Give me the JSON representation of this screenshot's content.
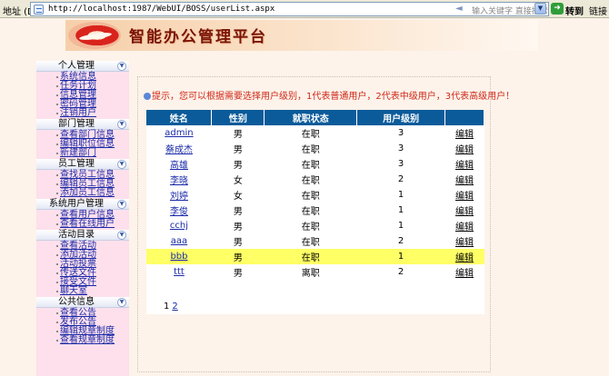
{
  "browser": {
    "address_label": "地址 (D)",
    "url": "http://localhost:1987/WebUI/BOSS/userList.aspx",
    "search_hint": "输入关键字 直接搜索",
    "go_label": "转到",
    "links_label": "链接"
  },
  "banner": {
    "title": "智能办公管理平台"
  },
  "sidebar": {
    "sections": [
      {
        "title": "个人管理",
        "items": [
          "系统信息",
          "任务计划",
          "信息管理",
          "密码管理",
          "注销用户"
        ]
      },
      {
        "title": "部门管理",
        "items": [
          "查看部门信息",
          "编辑职位信息",
          "新建部门"
        ]
      },
      {
        "title": "员工管理",
        "items": [
          "查找员工信息",
          "编辑员工信息",
          "添加员工信息"
        ]
      },
      {
        "title": "系统用户管理",
        "items": [
          "查看用户信息",
          "查看在线用户"
        ]
      },
      {
        "title": "活动目录",
        "items": [
          "查看活动",
          "添加活动",
          "活动投票",
          "传送文件",
          "接受文件",
          "聊天室"
        ]
      },
      {
        "title": "公共信息",
        "items": [
          "查看公告",
          "发布公告",
          "编辑规章制度",
          "查看规章制度"
        ]
      }
    ]
  },
  "hint": "提示，您可以根据需要选择用户级别，1代表普通用户，2代表中级用户，3代表高级用户！",
  "table": {
    "headers": [
      "姓名",
      "性别",
      "就职状态",
      "用户级别",
      ""
    ],
    "rows": [
      {
        "name": "admin",
        "gender": "男",
        "status": "在职",
        "level": "3",
        "action": "编辑"
      },
      {
        "name": "蔡成杰",
        "gender": "男",
        "status": "在职",
        "level": "3",
        "action": "编辑"
      },
      {
        "name": "高雄",
        "gender": "男",
        "status": "在职",
        "level": "3",
        "action": "编辑"
      },
      {
        "name": "李晓",
        "gender": "女",
        "status": "在职",
        "level": "2",
        "action": "编辑"
      },
      {
        "name": "刘婷",
        "gender": "女",
        "status": "在职",
        "level": "1",
        "action": "编辑"
      },
      {
        "name": "李俊",
        "gender": "男",
        "status": "在职",
        "level": "1",
        "action": "编辑"
      },
      {
        "name": "cchj",
        "gender": "男",
        "status": "在职",
        "level": "1",
        "action": "编辑"
      },
      {
        "name": "aaa",
        "gender": "男",
        "status": "在职",
        "level": "2",
        "action": "编辑"
      },
      {
        "name": "bbb",
        "gender": "男",
        "status": "在职",
        "level": "1",
        "action": "编辑",
        "highlighted": true
      },
      {
        "name": "ttt",
        "gender": "男",
        "status": "离职",
        "level": "2",
        "action": "编辑"
      }
    ]
  },
  "pager": {
    "current": "1",
    "next": "2"
  },
  "colors": {
    "header_bg": "#0b5b9a",
    "highlight_row": "#ffff66",
    "hint_text": "#d0281a",
    "sidebar_bg": "#fde0ec"
  }
}
